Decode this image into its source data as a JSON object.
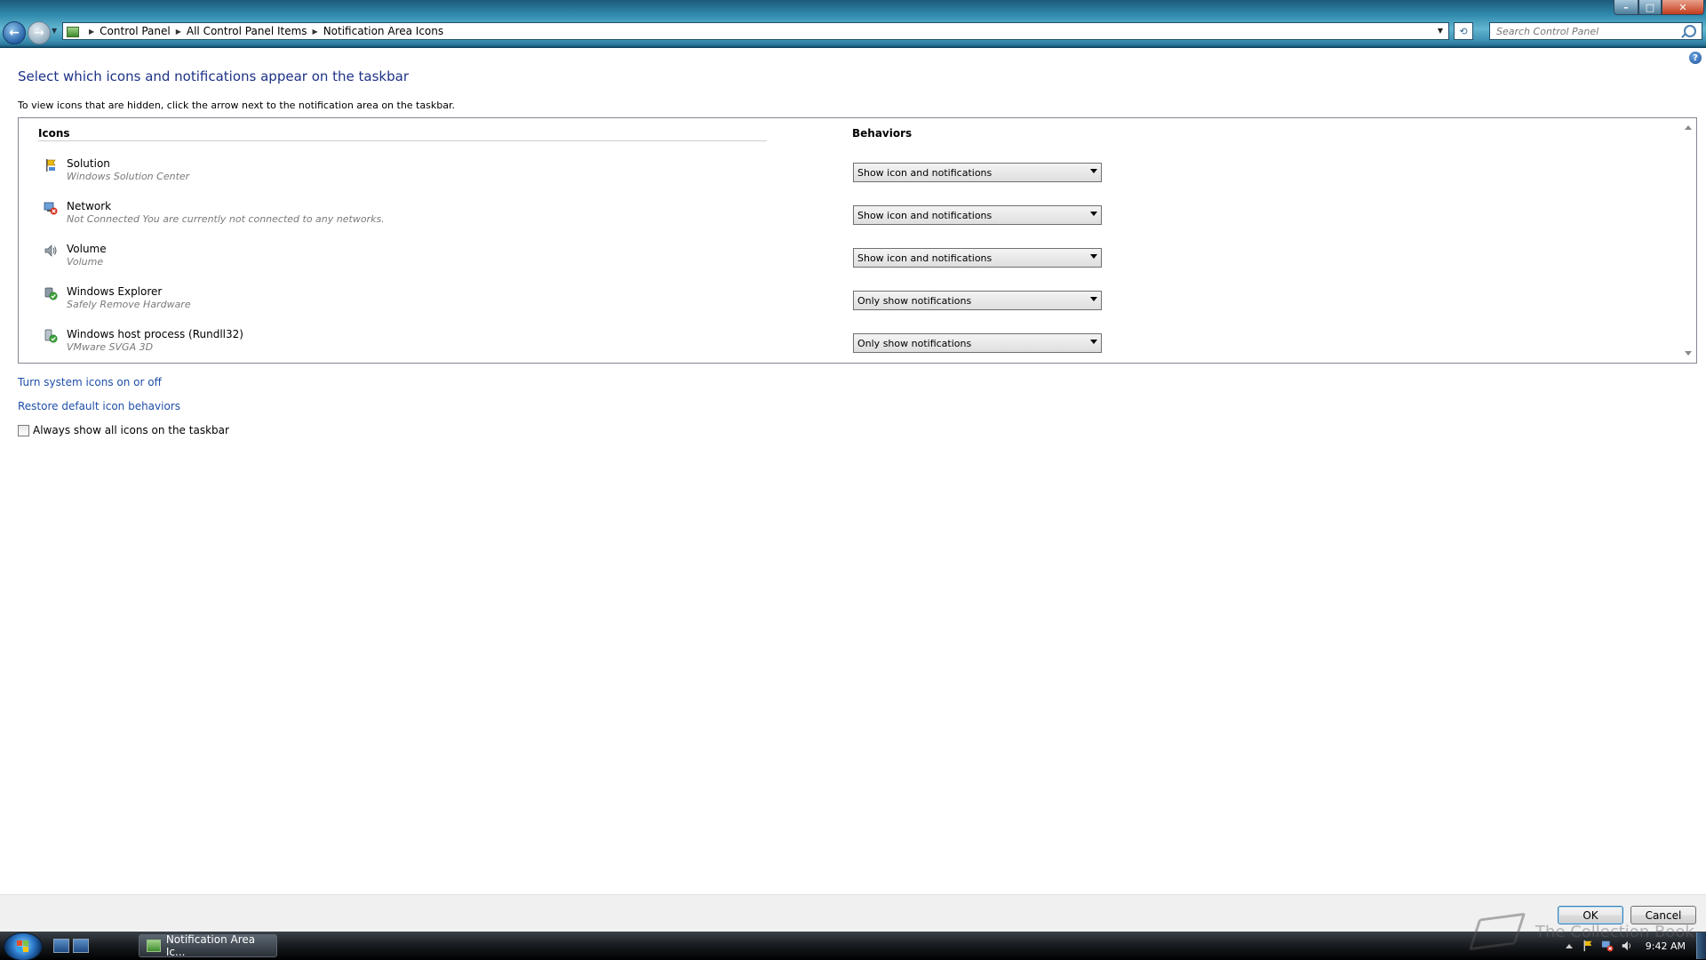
{
  "address_bar": {
    "breadcrumbs": [
      "Control Panel",
      "All Control Panel Items",
      "Notification Area Icons"
    ],
    "search_placeholder": "Search Control Panel"
  },
  "page": {
    "title": "Select which icons and notifications appear on the taskbar",
    "instruction": "To view icons that are hidden, click the arrow next to the notification area on the taskbar.",
    "col_icons": "Icons",
    "col_behaviors": "Behaviors",
    "rows": [
      {
        "name": "Solution",
        "desc": "Windows Solution Center",
        "behavior": "Show icon and notifications",
        "icon": "flag-icon"
      },
      {
        "name": "Network",
        "desc": "Not Connected You are currently not connected to any networks.",
        "behavior": "Show icon and notifications",
        "icon": "network-disconnected-icon"
      },
      {
        "name": "Volume",
        "desc": "Volume",
        "behavior": "Show icon and notifications",
        "icon": "speaker-icon"
      },
      {
        "name": "Windows Explorer",
        "desc": "Safely Remove Hardware",
        "behavior": "Only show notifications",
        "icon": "safely-remove-hardware-icon"
      },
      {
        "name": "Windows host process (Rundll32)",
        "desc": "VMware SVGA 3D",
        "behavior": "Only show notifications",
        "icon": "display-adapter-icon"
      }
    ],
    "link_system_icons": "Turn system icons on or off",
    "link_restore": "Restore default icon behaviors",
    "checkbox_label": "Always show all icons on the taskbar"
  },
  "dialog": {
    "ok": "OK",
    "cancel": "Cancel"
  },
  "taskbar": {
    "task_label": "Notification Area Ic...",
    "clock": "9:42 AM"
  },
  "watermark": {
    "text": "The Collection Book"
  }
}
